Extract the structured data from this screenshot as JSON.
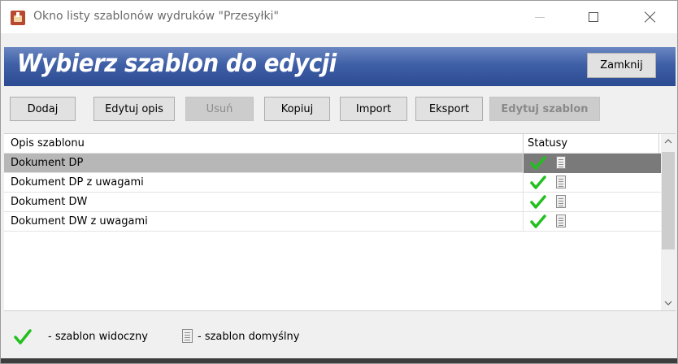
{
  "window": {
    "title": "Okno listy szablonów wydruków \"Przesyłki\"",
    "icons": {
      "app": "app-icon",
      "minimize": "minimize-icon",
      "maximize": "maximize-icon",
      "close": "close-icon"
    }
  },
  "header": {
    "title": "Wybierz szablon do edycji",
    "close_label": "Zamknij",
    "accent": "#3f5fa6"
  },
  "toolbar": {
    "add": "Dodaj",
    "edit_desc": "Edytuj opis",
    "delete": "Usuń",
    "copy": "Kopiuj",
    "import": "Import",
    "export": "Eksport",
    "edit_template": "Edytuj szablon"
  },
  "grid": {
    "col_desc": "Opis szablonu",
    "col_status": "Statusy",
    "rows": [
      {
        "desc": "Dokument DP",
        "visible": true,
        "default": true,
        "selected": true
      },
      {
        "desc": "Dokument DP z uwagami",
        "visible": true,
        "default": true,
        "selected": false
      },
      {
        "desc": "Dokument DW",
        "visible": true,
        "default": true,
        "selected": false
      },
      {
        "desc": "Dokument DW z uwagami",
        "visible": true,
        "default": true,
        "selected": false
      }
    ]
  },
  "legend": {
    "visible_label": "- szablon widoczny",
    "default_label": "- szablon domyślny",
    "check_color": "#22c01f"
  }
}
